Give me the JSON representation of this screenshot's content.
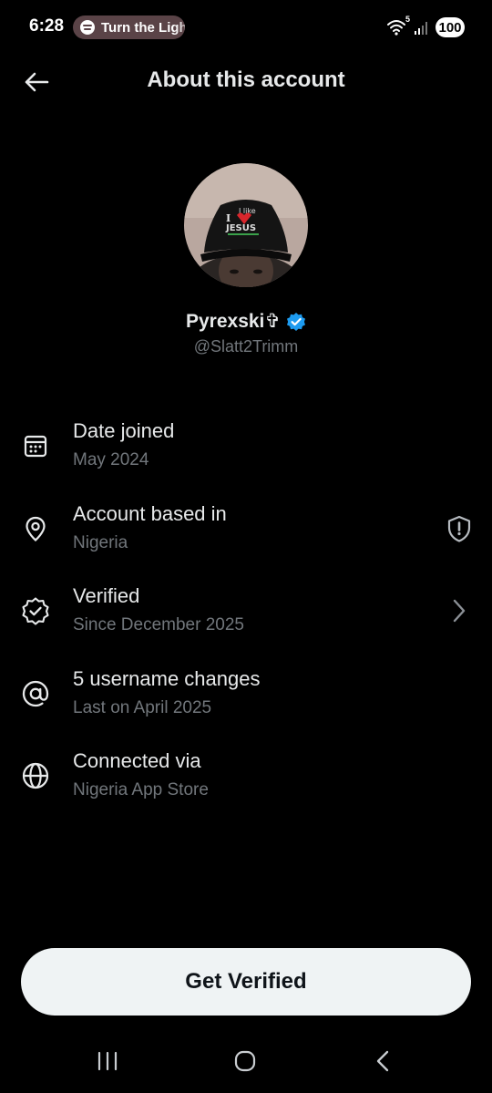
{
  "status_bar": {
    "time": "6:28",
    "media_text": "Turn the Lights",
    "wifi_badge": "5",
    "battery": "100"
  },
  "header": {
    "title": "About this account"
  },
  "profile": {
    "display_name": "Pyrexski✞",
    "handle": "@Slatt2Trimm",
    "verified_color": "#1d9bf0"
  },
  "info_rows": [
    {
      "icon": "calendar-icon",
      "title": "Date joined",
      "subtitle": "May 2024"
    },
    {
      "icon": "location-pin-icon",
      "title": "Account based in",
      "subtitle": "Nigeria",
      "trailing_icon": "shield-alert-icon"
    },
    {
      "icon": "verified-badge-icon",
      "title": "Verified",
      "subtitle": "Since December 2025",
      "trailing_icon": "chevron-right-icon"
    },
    {
      "icon": "at-sign-icon",
      "title": "5 username changes",
      "subtitle": "Last on April 2025"
    },
    {
      "icon": "globe-icon",
      "title": "Connected via",
      "subtitle": "Nigeria App Store"
    }
  ],
  "cta": {
    "label": "Get Verified"
  },
  "nav_bar": {
    "buttons": [
      "recent-apps-icon",
      "home-icon",
      "back-icon"
    ]
  }
}
